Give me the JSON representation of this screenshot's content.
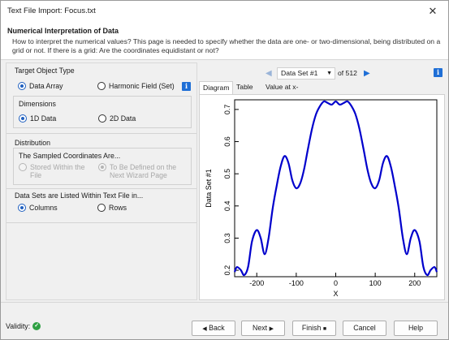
{
  "window": {
    "title": "Text File Import: Focus.txt",
    "close_glyph": "✕"
  },
  "header": {
    "title": "Numerical Interpretation of Data",
    "description": "How to interpret the numerical values? This page is needed to specify whether the data are one- or two-dimensional, being distributed on a grid or not. If there is a grid: Are the coordinates equidistant or not?"
  },
  "target_object": {
    "title": "Target Object Type",
    "options": [
      {
        "label": "Data Array",
        "checked": true
      },
      {
        "label": "Harmonic Field (Set)",
        "checked": false
      }
    ],
    "info_icon": "info-icon",
    "dimensions": {
      "title": "Dimensions",
      "options": [
        {
          "label": "1D Data",
          "checked": true
        },
        {
          "label": "2D Data",
          "checked": false
        }
      ]
    }
  },
  "distribution": {
    "title": "Distribution",
    "sampled_title": "The Sampled Coordinates Are...",
    "options": [
      {
        "line1": "Stored Within the",
        "line2": "File",
        "checked": false,
        "disabled": true
      },
      {
        "line1": "To Be Defined on the",
        "line2": "Next Wizard Page",
        "checked": true,
        "disabled": true
      }
    ]
  },
  "listing": {
    "title": "Data Sets are Listed Within Text File in...",
    "options": [
      {
        "label": "Columns",
        "checked": true
      },
      {
        "label": "Rows",
        "checked": false
      }
    ]
  },
  "dataset_nav": {
    "prev_icon": "chevron-left-icon",
    "next_icon": "chevron-right-icon",
    "selected": "Data Set #1",
    "of_label": "of 512"
  },
  "tabs": [
    "Diagram",
    "Table",
    "Value at x-Coordinate"
  ],
  "active_tab": 0,
  "chart_data": {
    "type": "line",
    "title": "",
    "xlabel": "X",
    "ylabel": "Data Set #1",
    "xlim": [
      -256,
      256
    ],
    "ylim": [
      0.18,
      0.73
    ],
    "x_ticks": [
      -200,
      -100,
      0,
      100,
      200
    ],
    "y_ticks": [
      0.2,
      0.3,
      0.4,
      0.5,
      0.6,
      0.7
    ],
    "grid": false,
    "color": "#0000cc",
    "series": [
      {
        "x": [
          -256,
          -250,
          -240,
          -232,
          -222,
          -212,
          -200,
          -190,
          -180,
          -170,
          -160,
          -150,
          -140,
          -130,
          -120,
          -110,
          -100,
          -90,
          -80,
          -70,
          -60,
          -50,
          -40,
          -30,
          -20,
          -10,
          0,
          10,
          20,
          30,
          40,
          50,
          60,
          70,
          80,
          90,
          100,
          110,
          120,
          130,
          140,
          150,
          160,
          170,
          180,
          190,
          200,
          212,
          222,
          232,
          240,
          250,
          256
        ],
        "y": [
          0.195,
          0.21,
          0.2,
          0.185,
          0.21,
          0.29,
          0.325,
          0.3,
          0.25,
          0.3,
          0.39,
          0.46,
          0.52,
          0.555,
          0.535,
          0.48,
          0.455,
          0.47,
          0.515,
          0.58,
          0.64,
          0.685,
          0.71,
          0.725,
          0.72,
          0.715,
          0.725,
          0.715,
          0.72,
          0.725,
          0.71,
          0.685,
          0.64,
          0.58,
          0.515,
          0.47,
          0.455,
          0.48,
          0.535,
          0.555,
          0.52,
          0.46,
          0.39,
          0.3,
          0.25,
          0.3,
          0.325,
          0.29,
          0.21,
          0.185,
          0.2,
          0.21,
          0.195
        ]
      }
    ]
  },
  "footer": {
    "validity_label": "Validity:",
    "buttons": {
      "back": "Back",
      "next": "Next",
      "finish": "Finish",
      "cancel": "Cancel",
      "help": "Help"
    }
  },
  "colors": {
    "accent": "#1f5fbf",
    "chart_line": "#0000cc",
    "ok_green": "#2ea043"
  }
}
